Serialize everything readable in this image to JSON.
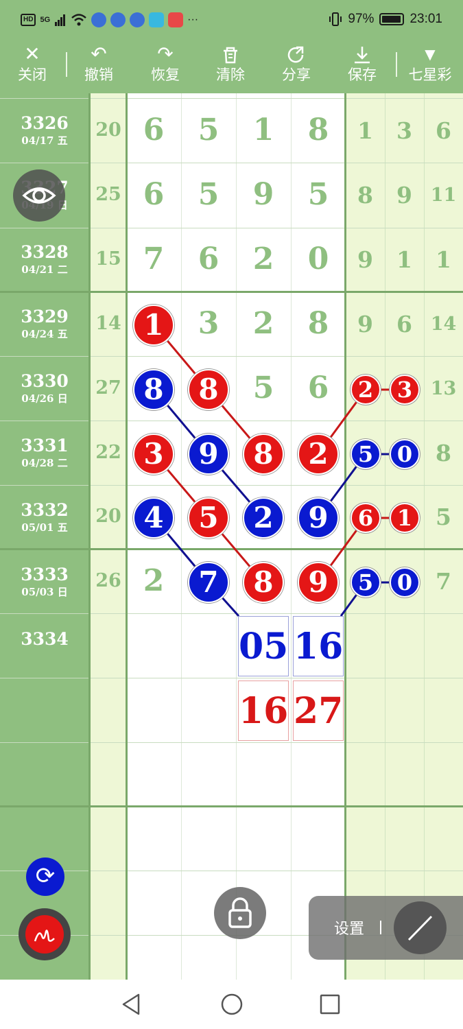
{
  "status_bar": {
    "network": "HD",
    "signal": "5G",
    "battery": "97%",
    "time": "23:01"
  },
  "toolbar": {
    "close": "关闭",
    "undo": "撤销",
    "redo": "恢复",
    "clear": "清除",
    "share": "分享",
    "save": "保存",
    "lottery": "七星彩"
  },
  "rows": [
    {
      "issue": "3326",
      "date": "04/17 五",
      "sum": "20",
      "d": [
        "6",
        "5",
        "1",
        "8"
      ],
      "r": [
        "1",
        "3",
        "6"
      ]
    },
    {
      "issue": "3327",
      "date": "04/19 日",
      "sum": "25",
      "d": [
        "6",
        "5",
        "9",
        "5"
      ],
      "r": [
        "8",
        "9",
        "11"
      ]
    },
    {
      "issue": "3328",
      "date": "04/21 二",
      "sum": "15",
      "d": [
        "7",
        "6",
        "2",
        "0"
      ],
      "r": [
        "9",
        "1",
        "1"
      ]
    },
    {
      "issue": "3329",
      "date": "04/24 五",
      "sum": "14",
      "d": [
        "1",
        "3",
        "2",
        "8"
      ],
      "r": [
        "9",
        "6",
        "14"
      ]
    },
    {
      "issue": "3330",
      "date": "04/26 日",
      "sum": "27",
      "d": [
        "8",
        "8",
        "5",
        "6"
      ],
      "r": [
        "2",
        "3",
        "13"
      ]
    },
    {
      "issue": "3331",
      "date": "04/28 二",
      "sum": "22",
      "d": [
        "3",
        "9",
        "8",
        "2"
      ],
      "r": [
        "5",
        "0",
        "8"
      ]
    },
    {
      "issue": "3332",
      "date": "05/01 五",
      "sum": "20",
      "d": [
        "4",
        "5",
        "2",
        "9"
      ],
      "r": [
        "6",
        "1",
        "5"
      ]
    },
    {
      "issue": "3333",
      "date": "05/03 日",
      "sum": "26",
      "d": [
        "2",
        "7",
        "8",
        "9"
      ],
      "r": [
        "5",
        "0",
        "7"
      ]
    },
    {
      "issue": "3334",
      "date": "",
      "sum": "",
      "d": [
        "",
        "",
        "",
        ""
      ],
      "r": [
        "",
        "",
        ""
      ]
    }
  ],
  "predictions": {
    "blue": [
      "05",
      "16"
    ],
    "red": [
      "16",
      "27"
    ]
  },
  "settings": {
    "label": "设置"
  },
  "colors": {
    "green": "#8fbf80",
    "red": "#e41616",
    "blue": "#0a1ad0"
  }
}
